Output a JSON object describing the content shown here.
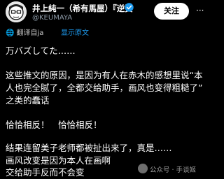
{
  "header": {
    "display_name": "井上純一（希有馬屋）『逆資",
    "handle": "@KEUMAYA",
    "follow_label": "关注",
    "more_label": "···"
  },
  "translation": {
    "label": "翻译自ja",
    "show_original": "显示原文"
  },
  "post": {
    "lines": [
      "万バズしてた……",
      "这些推文的原因，是因为有人在赤木的感想里说“本",
      "人也完全腻了，全都交给助手，画风也变得粗糙了”",
      "之类的蠢话",
      "恰恰相反！　恰恰相反！",
      "结果连留美子老师都被扯出来了，真是……",
      "画风改变是因为本人在画啊",
      "交给助手反而不会变"
    ]
  },
  "watermark": {
    "text": "公众号 · 手谈姬"
  }
}
